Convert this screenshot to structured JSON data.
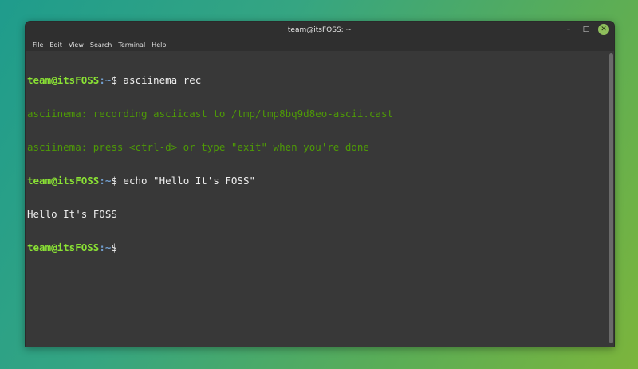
{
  "window": {
    "title": "team@itsFOSS: ~",
    "controls": {
      "minimize": "–",
      "maximize": "□",
      "close": "✕"
    }
  },
  "menu": [
    "File",
    "Edit",
    "View",
    "Search",
    "Terminal",
    "Help"
  ],
  "terminal": {
    "prompt": {
      "user": "team@itsFOSS",
      "path": ":~",
      "symbol": "$"
    },
    "lines": [
      {
        "type": "command",
        "text": " asciinema rec"
      },
      {
        "type": "info",
        "text": "asciinema: recording asciicast to /tmp/tmp8bq9d8eo-ascii.cast"
      },
      {
        "type": "info",
        "text": "asciinema: press <ctrl-d> or type \"exit\" when you're done"
      },
      {
        "type": "command",
        "text": " echo \"Hello It's FOSS\""
      },
      {
        "type": "output",
        "text": "Hello It's FOSS"
      },
      {
        "type": "command",
        "text": ""
      }
    ]
  },
  "colors": {
    "prompt_user": "#8ae234",
    "prompt_path": "#729fcf",
    "info_text": "#4e9a06",
    "background": "#383838"
  }
}
